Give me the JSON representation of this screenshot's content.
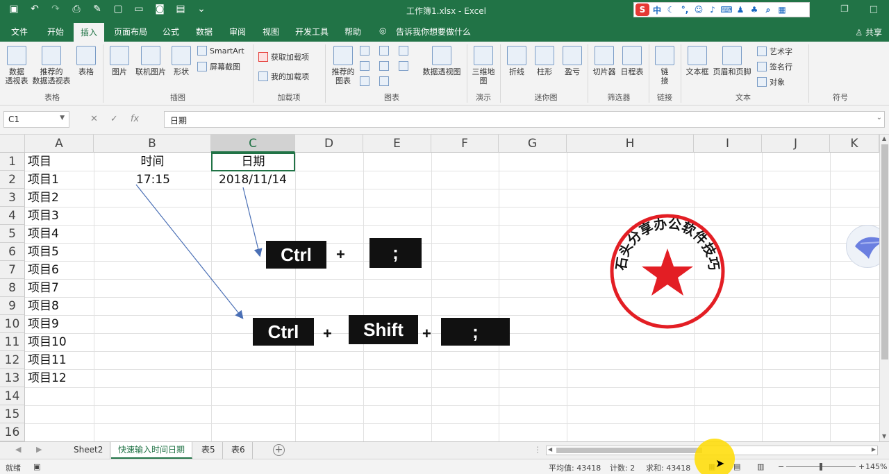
{
  "window": {
    "title": "工作簿1.xlsx  -  Excel",
    "share": "共享"
  },
  "ime_toolbar": {
    "logo": "S",
    "mode": "中"
  },
  "ribbon_tabs": [
    "文件",
    "开始",
    "插入",
    "页面布局",
    "公式",
    "数据",
    "审阅",
    "视图",
    "开发工具",
    "帮助"
  ],
  "active_tab": "插入",
  "tell_me": "告诉我你想要做什么",
  "ribbon": {
    "tables": {
      "group": "表格",
      "pivot": "数据\n透视表",
      "rec_pivot": "推荐的\n数据透视表",
      "table": "表格"
    },
    "illustrations": {
      "group": "插图",
      "picture": "图片",
      "online_picture": "联机图片",
      "shapes": "形状",
      "smartart": "SmartArt",
      "screenshot": "屏幕截图"
    },
    "addins": {
      "group": "加载项",
      "get": "获取加载项",
      "my": "我的加载项"
    },
    "charts": {
      "group": "图表",
      "recommended": "推荐的\n图表",
      "pivot_chart": "数据透视图"
    },
    "tours": {
      "group": "演示",
      "map3d": "三维地\n图"
    },
    "sparklines": {
      "group": "迷你图",
      "line": "折线",
      "column": "柱形",
      "winloss": "盈亏"
    },
    "filters": {
      "group": "筛选器",
      "slicer": "切片器",
      "timeline": "日程表"
    },
    "links": {
      "group": "链接",
      "link": "链\n接"
    },
    "text": {
      "group": "文本",
      "textbox": "文本框",
      "header": "页眉和页脚",
      "wordart": "艺术字",
      "signature": "签名行",
      "object": "对象"
    },
    "symbols": {
      "group": "符号"
    }
  },
  "formula_bar": {
    "name_box": "C1",
    "content": "日期"
  },
  "columns": [
    "A",
    "B",
    "C",
    "D",
    "E",
    "F",
    "G",
    "H",
    "I",
    "J",
    "K"
  ],
  "rows": [
    "1",
    "2",
    "3",
    "4",
    "5",
    "6",
    "7",
    "8",
    "9",
    "10",
    "11",
    "12",
    "13",
    "14",
    "15",
    "16"
  ],
  "cells": {
    "A": [
      "项目",
      "项目1",
      "项目2",
      "项目3",
      "项目4",
      "项目5",
      "项目6",
      "项目7",
      "项目8",
      "项目9",
      "项目10",
      "项目11",
      "项目12"
    ],
    "B1": "时间",
    "B2": "17:15",
    "C1": "日期",
    "C2": "2018/11/14"
  },
  "shortcuts": {
    "date": {
      "key1": "Ctrl",
      "plus": "+",
      "key2": ";"
    },
    "time": {
      "key1": "Ctrl",
      "plus1": "+",
      "key2": "Shift",
      "plus2": "+",
      "key3": ";"
    }
  },
  "stamp": {
    "text": "石头分享办公软件技巧",
    "color": "#e31e24"
  },
  "sheets": [
    "Sheet2",
    "快速输入时间日期",
    "表5",
    "表6"
  ],
  "active_sheet": "快速输入时间日期",
  "status": {
    "mode": "就绪",
    "average": "平均值: 43418",
    "count": "计数: 2",
    "sum": "求和: 43418",
    "zoom": "145%"
  },
  "colors": {
    "excel_green": "#217346",
    "arrow": "#4a6fb5"
  }
}
